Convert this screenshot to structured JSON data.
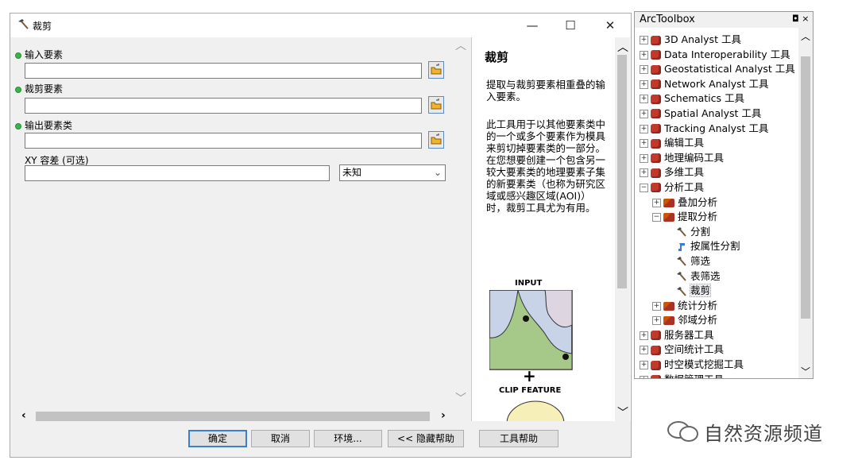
{
  "dialog": {
    "title": "裁剪",
    "buttons": {
      "minimize": "—",
      "maximize": "☐",
      "close": "✕"
    },
    "params": [
      {
        "label": "输入要素",
        "required": true,
        "value": ""
      },
      {
        "label": "裁剪要素",
        "required": true,
        "value": ""
      },
      {
        "label": "输出要素类",
        "required": true,
        "value": ""
      }
    ],
    "xy_tolerance": {
      "label": "XY 容差 (可选)",
      "value": "",
      "unit": "未知"
    },
    "footer": {
      "ok": "确定",
      "cancel": "取消",
      "environments": "环境...",
      "hide_help": "<< 隐藏帮助",
      "tool_help": "工具帮助"
    }
  },
  "help": {
    "title": "裁剪",
    "para1": "提取与裁剪要素相重叠的输入要素。",
    "para2": "此工具用于以其他要素类中的一个或多个要素作为模具来剪切掉要素类的一部分。在您想要创建一个包含另一较大要素类的地理要素子集的新要素类（也称为研究区域或感兴趣区域(AOI)）时，裁剪工具尤为有用。",
    "figure_input": "INPUT",
    "figure_plus": "+",
    "figure_clip": "CLIP FEATURE"
  },
  "toolbox": {
    "title": "ArcToolbox",
    "controls": "◘ ×",
    "items": [
      {
        "level": 0,
        "expander": "+",
        "type": "toolbox",
        "label": "3D Analyst 工具"
      },
      {
        "level": 0,
        "expander": "+",
        "type": "toolbox",
        "label": "Data Interoperability 工具"
      },
      {
        "level": 0,
        "expander": "+",
        "type": "toolbox",
        "label": "Geostatistical Analyst 工具"
      },
      {
        "level": 0,
        "expander": "+",
        "type": "toolbox",
        "label": "Network Analyst 工具"
      },
      {
        "level": 0,
        "expander": "+",
        "type": "toolbox",
        "label": "Schematics 工具"
      },
      {
        "level": 0,
        "expander": "+",
        "type": "toolbox",
        "label": "Spatial Analyst 工具"
      },
      {
        "level": 0,
        "expander": "+",
        "type": "toolbox",
        "label": "Tracking Analyst 工具"
      },
      {
        "level": 0,
        "expander": "+",
        "type": "toolbox",
        "label": "编辑工具"
      },
      {
        "level": 0,
        "expander": "+",
        "type": "toolbox",
        "label": "地理编码工具"
      },
      {
        "level": 0,
        "expander": "+",
        "type": "toolbox",
        "label": "多维工具"
      },
      {
        "level": 0,
        "expander": "−",
        "type": "toolbox",
        "label": "分析工具"
      },
      {
        "level": 1,
        "expander": "+",
        "type": "toolset",
        "label": "叠加分析"
      },
      {
        "level": 1,
        "expander": "−",
        "type": "toolset",
        "label": "提取分析"
      },
      {
        "level": 2,
        "expander": "",
        "type": "tool",
        "label": "分割"
      },
      {
        "level": 2,
        "expander": "",
        "type": "script",
        "label": "按属性分割"
      },
      {
        "level": 2,
        "expander": "",
        "type": "tool",
        "label": "筛选"
      },
      {
        "level": 2,
        "expander": "",
        "type": "tool",
        "label": "表筛选"
      },
      {
        "level": 2,
        "expander": "",
        "type": "tool",
        "label": "裁剪",
        "selected": true
      },
      {
        "level": 1,
        "expander": "+",
        "type": "toolset",
        "label": "统计分析"
      },
      {
        "level": 1,
        "expander": "+",
        "type": "toolset",
        "label": "邻域分析"
      },
      {
        "level": 0,
        "expander": "+",
        "type": "toolbox",
        "label": "服务器工具"
      },
      {
        "level": 0,
        "expander": "+",
        "type": "toolbox",
        "label": "空间统计工具"
      },
      {
        "level": 0,
        "expander": "+",
        "type": "toolbox",
        "label": "时空模式挖掘工具"
      },
      {
        "level": 0,
        "expander": "+",
        "type": "toolbox",
        "label": "数据管理工具"
      }
    ]
  },
  "watermark": {
    "text": "自然资源频道"
  }
}
